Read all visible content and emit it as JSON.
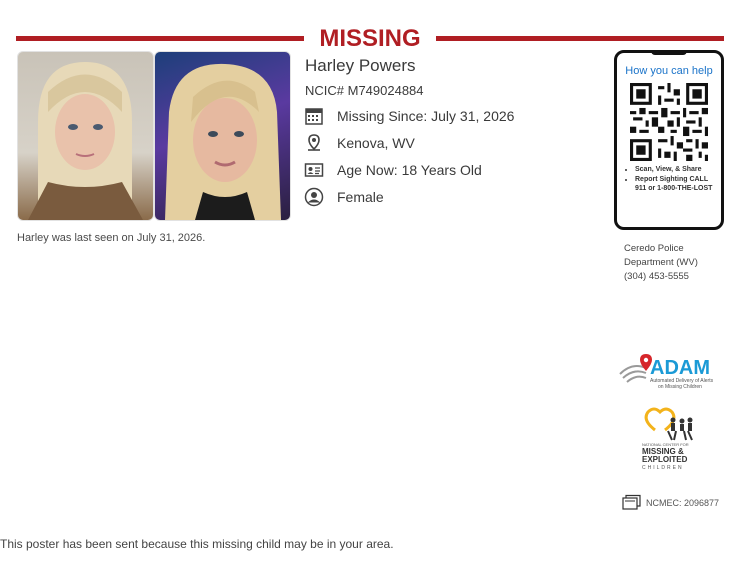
{
  "header": {
    "title": "MISSING",
    "accent_color": "#b01e23"
  },
  "person": {
    "name": "Harley Powers",
    "ncic": "NCIC# M749024884",
    "missing_since": "Missing Since: July 31, 2026",
    "location": "Kenova, WV",
    "age_now": "Age Now: 18 Years Old",
    "sex": "Female",
    "last_seen_note": "Harley was last seen on July 31, 2026."
  },
  "icons": {
    "calendar": "calendar-icon",
    "location": "location-pin-icon",
    "age": "id-card-icon",
    "sex": "person-icon"
  },
  "qr_panel": {
    "heading": "How you can help",
    "bullets": [
      "Scan, View, & Share",
      "Report Sighting CALL 911 or 1-800-THE-LOST"
    ]
  },
  "agency": {
    "line1": "Ceredo Police",
    "line2": "Department (WV)",
    "phone": "(304) 453-5555"
  },
  "logos": {
    "adam_word": "ADAM",
    "adam_tag1": "Automated Delivery of Alerts",
    "adam_tag2": "on Missing Children",
    "ncmec_line1": "NATIONAL CENTER FOR",
    "ncmec_line2": "MISSING &",
    "ncmec_line3": "EXPLOITED",
    "ncmec_line4": "CHILDREN"
  },
  "case": {
    "ncmec_number": "NCMEC: 2096877"
  },
  "footer": {
    "text": "This poster has been sent because this missing child may be in your area."
  }
}
